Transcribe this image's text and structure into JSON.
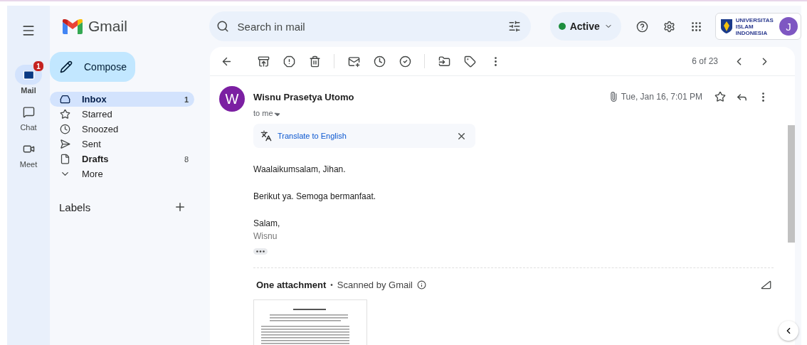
{
  "app": {
    "name": "Gmail"
  },
  "search": {
    "placeholder": "Search in mail"
  },
  "status": {
    "label": "Active",
    "color": "#1e8e3e"
  },
  "account": {
    "org_lines": [
      "UNIVERSITAS",
      "ISLAM",
      "INDONESIA"
    ],
    "initial": "J"
  },
  "rail": [
    {
      "kind": "mail",
      "label": "Mail",
      "badge": "1",
      "selected": true
    },
    {
      "kind": "chat",
      "label": "Chat",
      "selected": false
    },
    {
      "kind": "meet",
      "label": "Meet",
      "selected": false
    }
  ],
  "compose": {
    "label": "Compose"
  },
  "folders": [
    {
      "kind": "inbox",
      "label": "Inbox",
      "count": "1",
      "selected": true,
      "unread": true
    },
    {
      "kind": "starred",
      "label": "Starred",
      "selected": false,
      "unread": false
    },
    {
      "kind": "snoozed",
      "label": "Snoozed",
      "selected": false,
      "unread": false
    },
    {
      "kind": "sent",
      "label": "Sent",
      "selected": false,
      "unread": false
    },
    {
      "kind": "drafts",
      "label": "Drafts",
      "count": "8",
      "selected": false,
      "unread": true
    },
    {
      "kind": "more",
      "label": "More",
      "selected": false,
      "unread": false
    }
  ],
  "labels": {
    "title": "Labels"
  },
  "toolbar": {
    "pager": "6 of 23"
  },
  "message": {
    "avatar": "W",
    "sender": "Wisnu Prasetya Utomo",
    "recipient": "to me",
    "date": "Tue, Jan 16, 7:01 PM",
    "starred": false,
    "translate": "Translate to English",
    "body": [
      "Waalaikumsalam, Jihan.",
      "Berikut ya. Semoga bermanfaat."
    ],
    "signature": {
      "greeting": "Salam,",
      "name": "Wisnu"
    }
  },
  "attachments": {
    "title": "One attachment",
    "separator": "•",
    "scan_note": "Scanned by Gmail"
  }
}
